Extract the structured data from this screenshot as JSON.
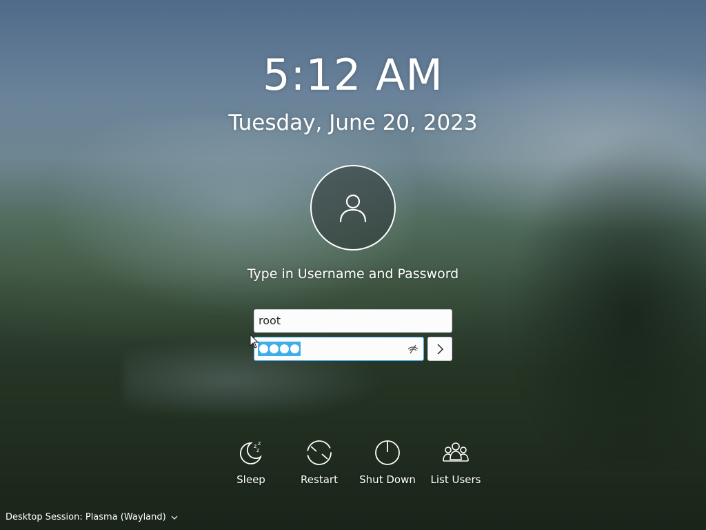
{
  "clock": {
    "time": "5:12 AM",
    "date": "Tuesday, June 20, 2023"
  },
  "login": {
    "avatar_icon": "user-icon",
    "prompt": "Type in Username and Password",
    "username_value": "root",
    "password_length": 4,
    "password_selected": true,
    "reveal_icon": "eye-hidden-icon",
    "submit_icon": "chevron-right-icon"
  },
  "actions": [
    {
      "label": "Sleep",
      "icon": "sleep-icon"
    },
    {
      "label": "Restart",
      "icon": "restart-icon"
    },
    {
      "label": "Shut Down",
      "icon": "power-icon"
    },
    {
      "label": "List Users",
      "icon": "users-icon"
    }
  ],
  "session": {
    "label": "Desktop Session: Plasma (Wayland)",
    "icon": "chevron-down-icon"
  },
  "colors": {
    "selection": "#3daee9",
    "field_bg": "#fcfcfc",
    "text": "#ffffff"
  }
}
